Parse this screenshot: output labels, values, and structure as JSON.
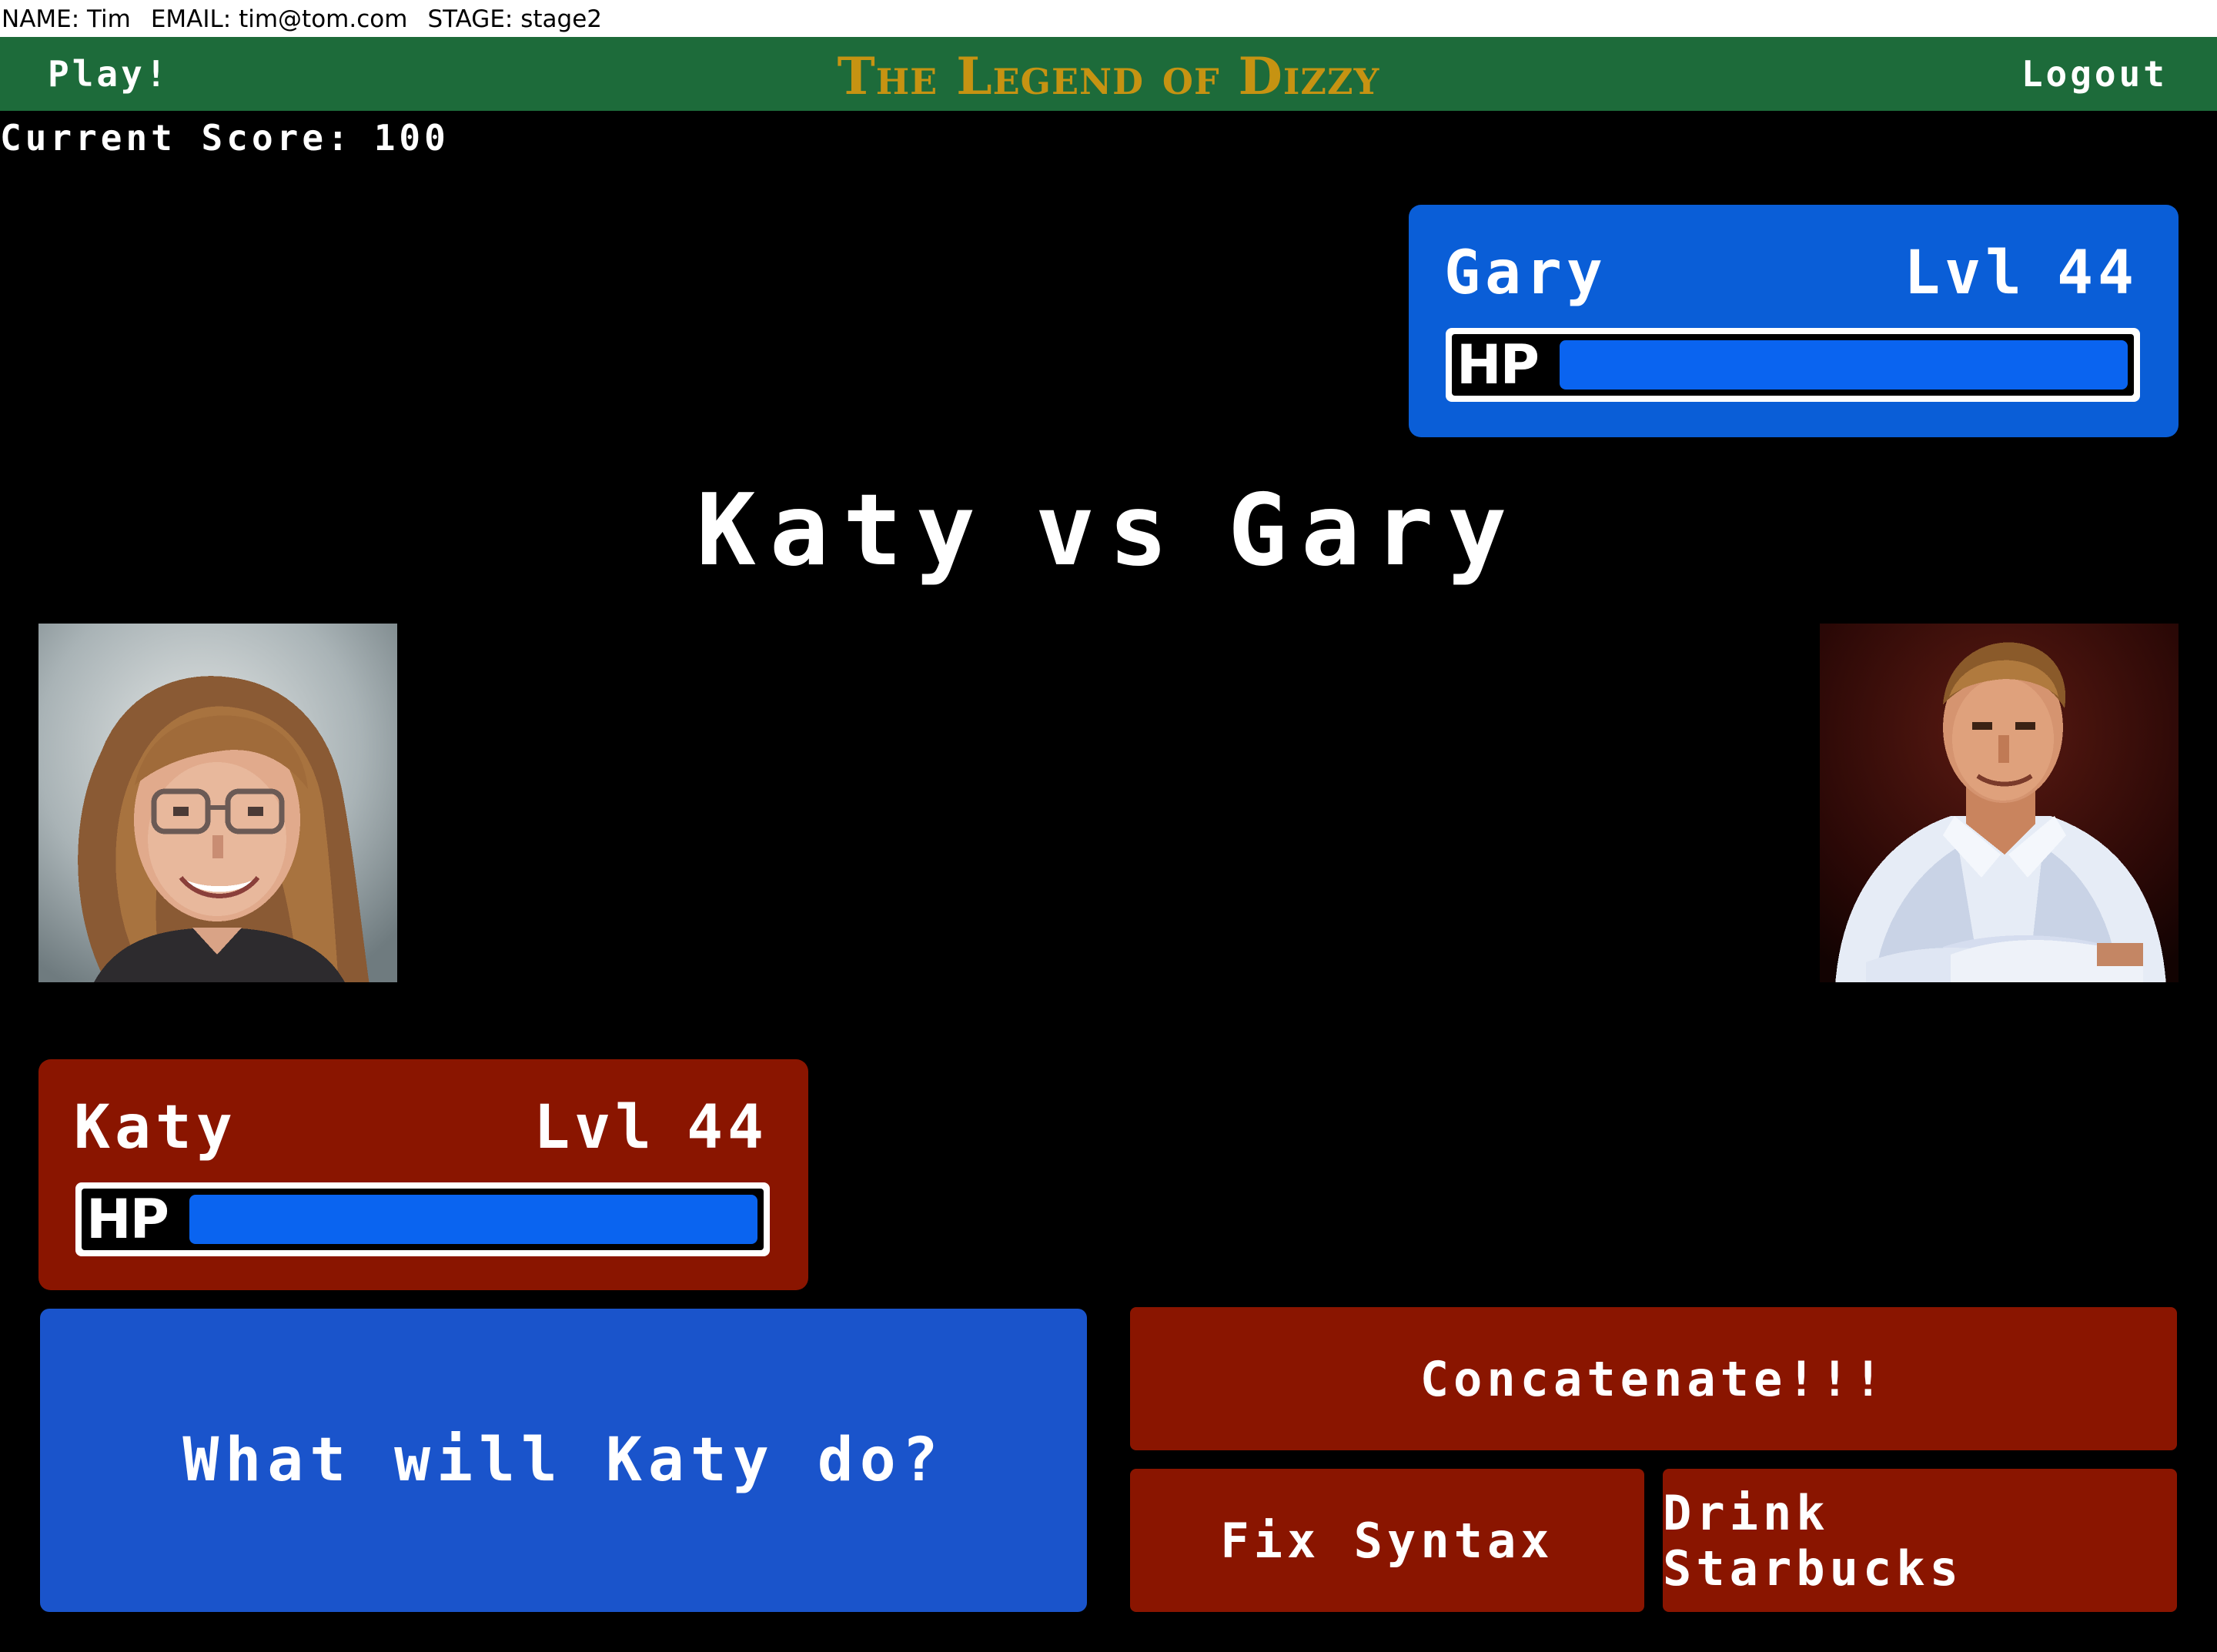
{
  "user_bar": {
    "name": "NAME: Tim",
    "email": "EMAIL: tim@tom.com",
    "stage": "STAGE: stage2"
  },
  "nav": {
    "play_label": "Play!",
    "title": "The Legend of Dizzy",
    "logout_label": "Logout",
    "background_color": "#1d6b3a",
    "title_color": "#c69312"
  },
  "score": {
    "label": "Current Score:",
    "value": "100"
  },
  "enemy": {
    "name": "Gary",
    "level_prefix": "Lvl",
    "level": "44",
    "hp_label": "HP",
    "hp_fraction": 1.0,
    "box_color": "#0a5ed7"
  },
  "player": {
    "name": "Katy",
    "level_prefix": "Lvl",
    "level": "44",
    "hp_label": "HP",
    "hp_fraction": 1.0,
    "box_color": "#8a1500"
  },
  "battle": {
    "left_name": "Katy",
    "vs": "vs",
    "right_name": "Gary",
    "prompt": "What will Katy do?"
  },
  "actions": {
    "primary": "Concatenate!!!",
    "secondary_1": "Fix Syntax",
    "secondary_2": "Drink Starbucks"
  },
  "colors": {
    "hp_fill": "#0a64f0",
    "prompt_box": "#1a54cb",
    "action_button": "#8a1500"
  }
}
